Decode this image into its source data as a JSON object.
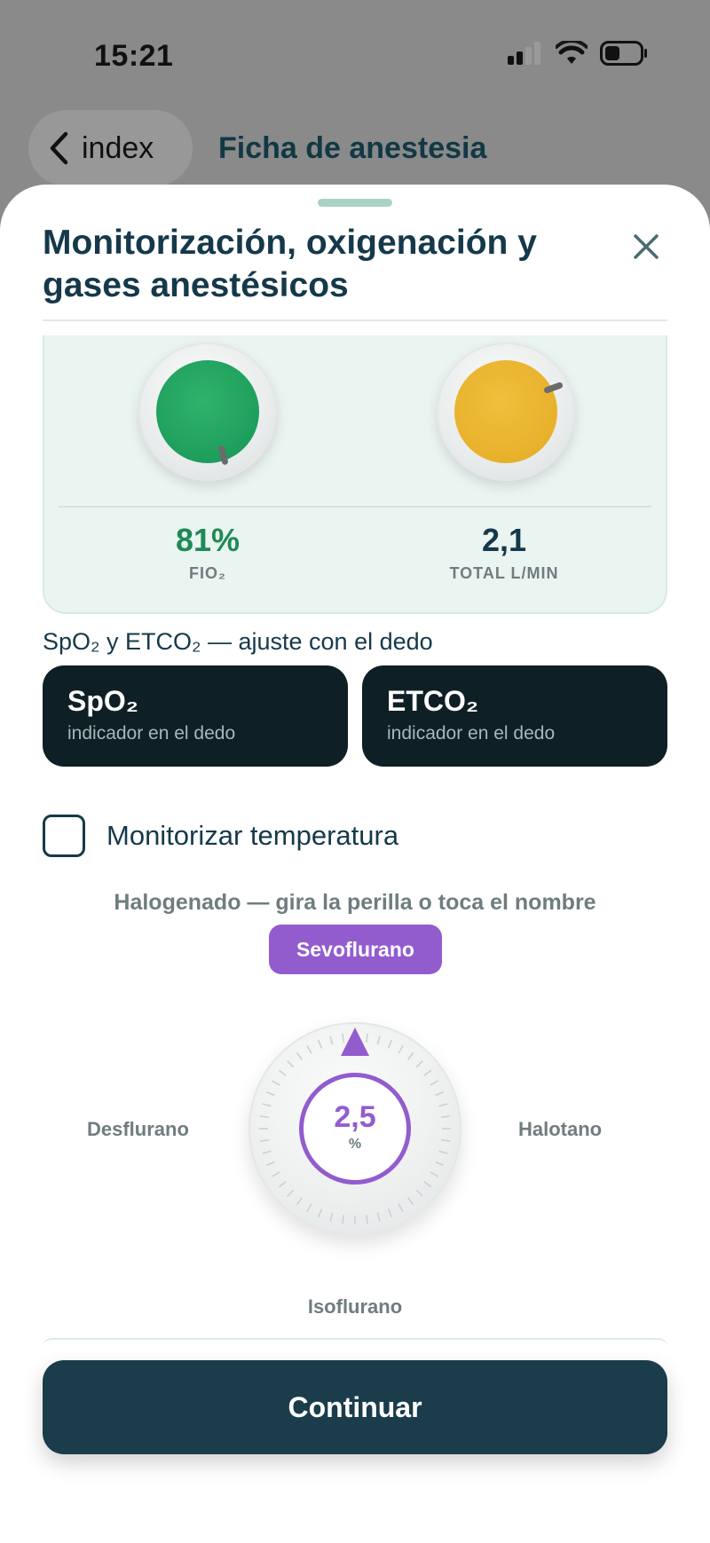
{
  "status": {
    "time": "15:21"
  },
  "nav": {
    "back_label": "index",
    "title": "Ficha de anestesia"
  },
  "sheet": {
    "title": "Monitorización, oxigenación y gases anestésicos"
  },
  "oxygen": {
    "fio2": {
      "value": "81%",
      "label": "FIO₂",
      "color": "#1e9e5c"
    },
    "flow": {
      "value": "2,1",
      "label": "TOTAL L/MIN",
      "color": "#e8b12c"
    }
  },
  "monitoring": {
    "section_label": "SpO₂ y ETCO₂ — ajuste con el dedo",
    "cards": [
      {
        "title": "SpO₂",
        "subtitle": "indicador en el dedo"
      },
      {
        "title": "ETCO₂",
        "subtitle": "indicador en el dedo"
      }
    ],
    "temperature_label": "Monitorizar temperatura",
    "temperature_checked": false
  },
  "halogenated": {
    "hint": "Halogenado — gira la perilla o toca el nombre",
    "selected": "Sevoflurano",
    "value": "2,5",
    "unit": "%",
    "options": {
      "left": "Desflurano",
      "right": "Halotano",
      "bottom": "Isoflurano"
    },
    "accent": "#925ccf"
  },
  "actions": {
    "continue_label": "Continuar"
  }
}
